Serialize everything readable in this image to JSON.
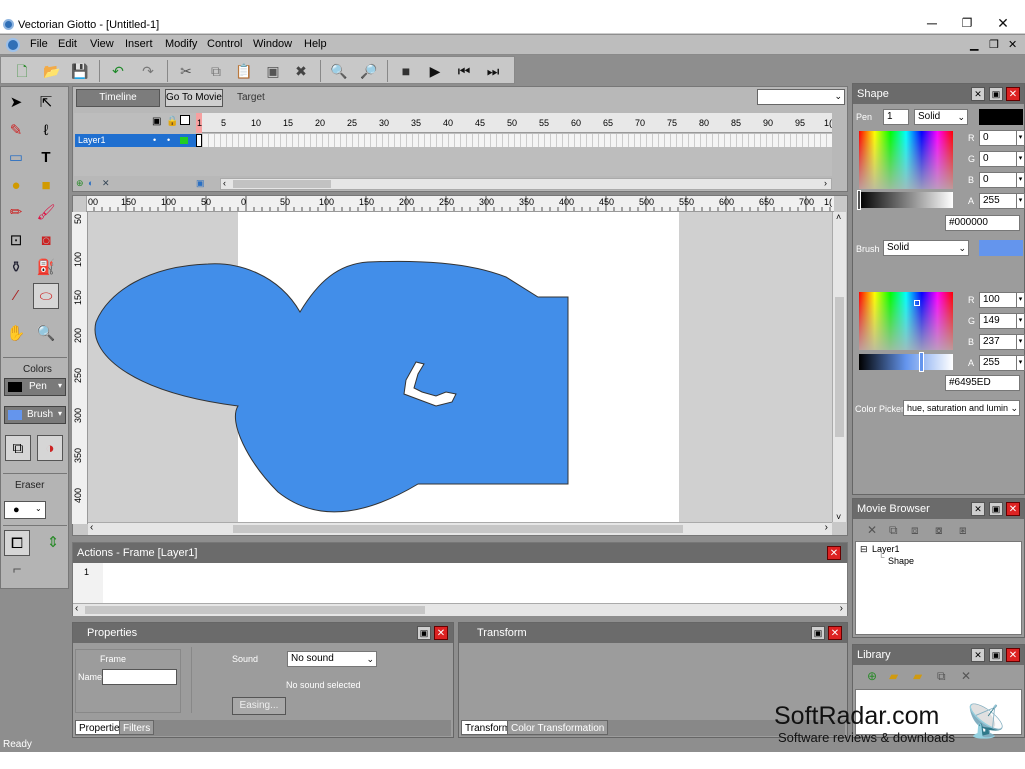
{
  "window": {
    "title": "Vectorian Giotto - [Untitled-1]",
    "min": "─",
    "max": "❐",
    "close": "✕"
  },
  "menu": [
    "File",
    "Edit",
    "View",
    "Insert",
    "Modify",
    "Control",
    "Window",
    "Help"
  ],
  "mdi": {
    "min": "▁",
    "restore": "❐",
    "close": "✕"
  },
  "timeline_panel": {
    "timeline_btn": "Timeline",
    "goto_btn": "Go To Movie",
    "target_label": "Target",
    "layer_name": "Layer1",
    "frame_numbers": [
      "1",
      "5",
      "10",
      "15",
      "20",
      "25",
      "30",
      "35",
      "40",
      "45",
      "50",
      "55",
      "60",
      "65",
      "70",
      "75",
      "80",
      "85",
      "90",
      "95",
      "1("
    ]
  },
  "stage": {
    "hruler": [
      "00",
      "150",
      "100",
      "50",
      "0",
      "50",
      "100",
      "150",
      "200",
      "250",
      "300",
      "350",
      "400",
      "450",
      "500",
      "550",
      "600",
      "650",
      "700",
      "1("
    ],
    "vruler": [
      "50",
      "100",
      "150",
      "200",
      "250",
      "300",
      "350",
      "400"
    ]
  },
  "tools": {
    "colors_label": "Colors",
    "pen_label": "Pen",
    "brush_label": "Brush",
    "eraser_label": "Eraser"
  },
  "actions": {
    "title": "Actions - Frame [Layer1]",
    "line1": "1"
  },
  "properties": {
    "title": "Properties",
    "frame_label": "Frame",
    "name_label": "Name",
    "sound_label": "Sound",
    "sound_value": "No sound",
    "no_sound_text": "No sound selected",
    "easing_btn": "Easing...",
    "tabs": [
      "Properties",
      "Filters"
    ]
  },
  "transform": {
    "title": "Transform",
    "tabs": [
      "Transform",
      "Color Transformation"
    ]
  },
  "shape": {
    "title": "Shape",
    "pen_label": "Pen",
    "pen_width": "1",
    "pen_style": "Solid",
    "pen_color": "#000000",
    "pen_rgba": {
      "R": "0",
      "G": "0",
      "B": "0",
      "A": "255"
    },
    "pen_hex": "#000000",
    "brush_label": "Brush",
    "brush_style": "Solid",
    "brush_color": "#6495ED",
    "brush_rgba": {
      "R": "100",
      "G": "149",
      "B": "237",
      "A": "255"
    },
    "brush_hex": "#6495ED",
    "picker_label": "Color Picker",
    "picker_value": "hue, saturation and lumin"
  },
  "movie_browser": {
    "title": "Movie Browser",
    "tree": [
      "Layer1",
      "Shape"
    ]
  },
  "library": {
    "title": "Library"
  },
  "status": "Ready",
  "watermark": {
    "main": "SoftRadar.com",
    "sub": "Software reviews & downloads"
  },
  "colors": {
    "shape_fill": "#428ee9",
    "selection": "#1f6fd0"
  }
}
